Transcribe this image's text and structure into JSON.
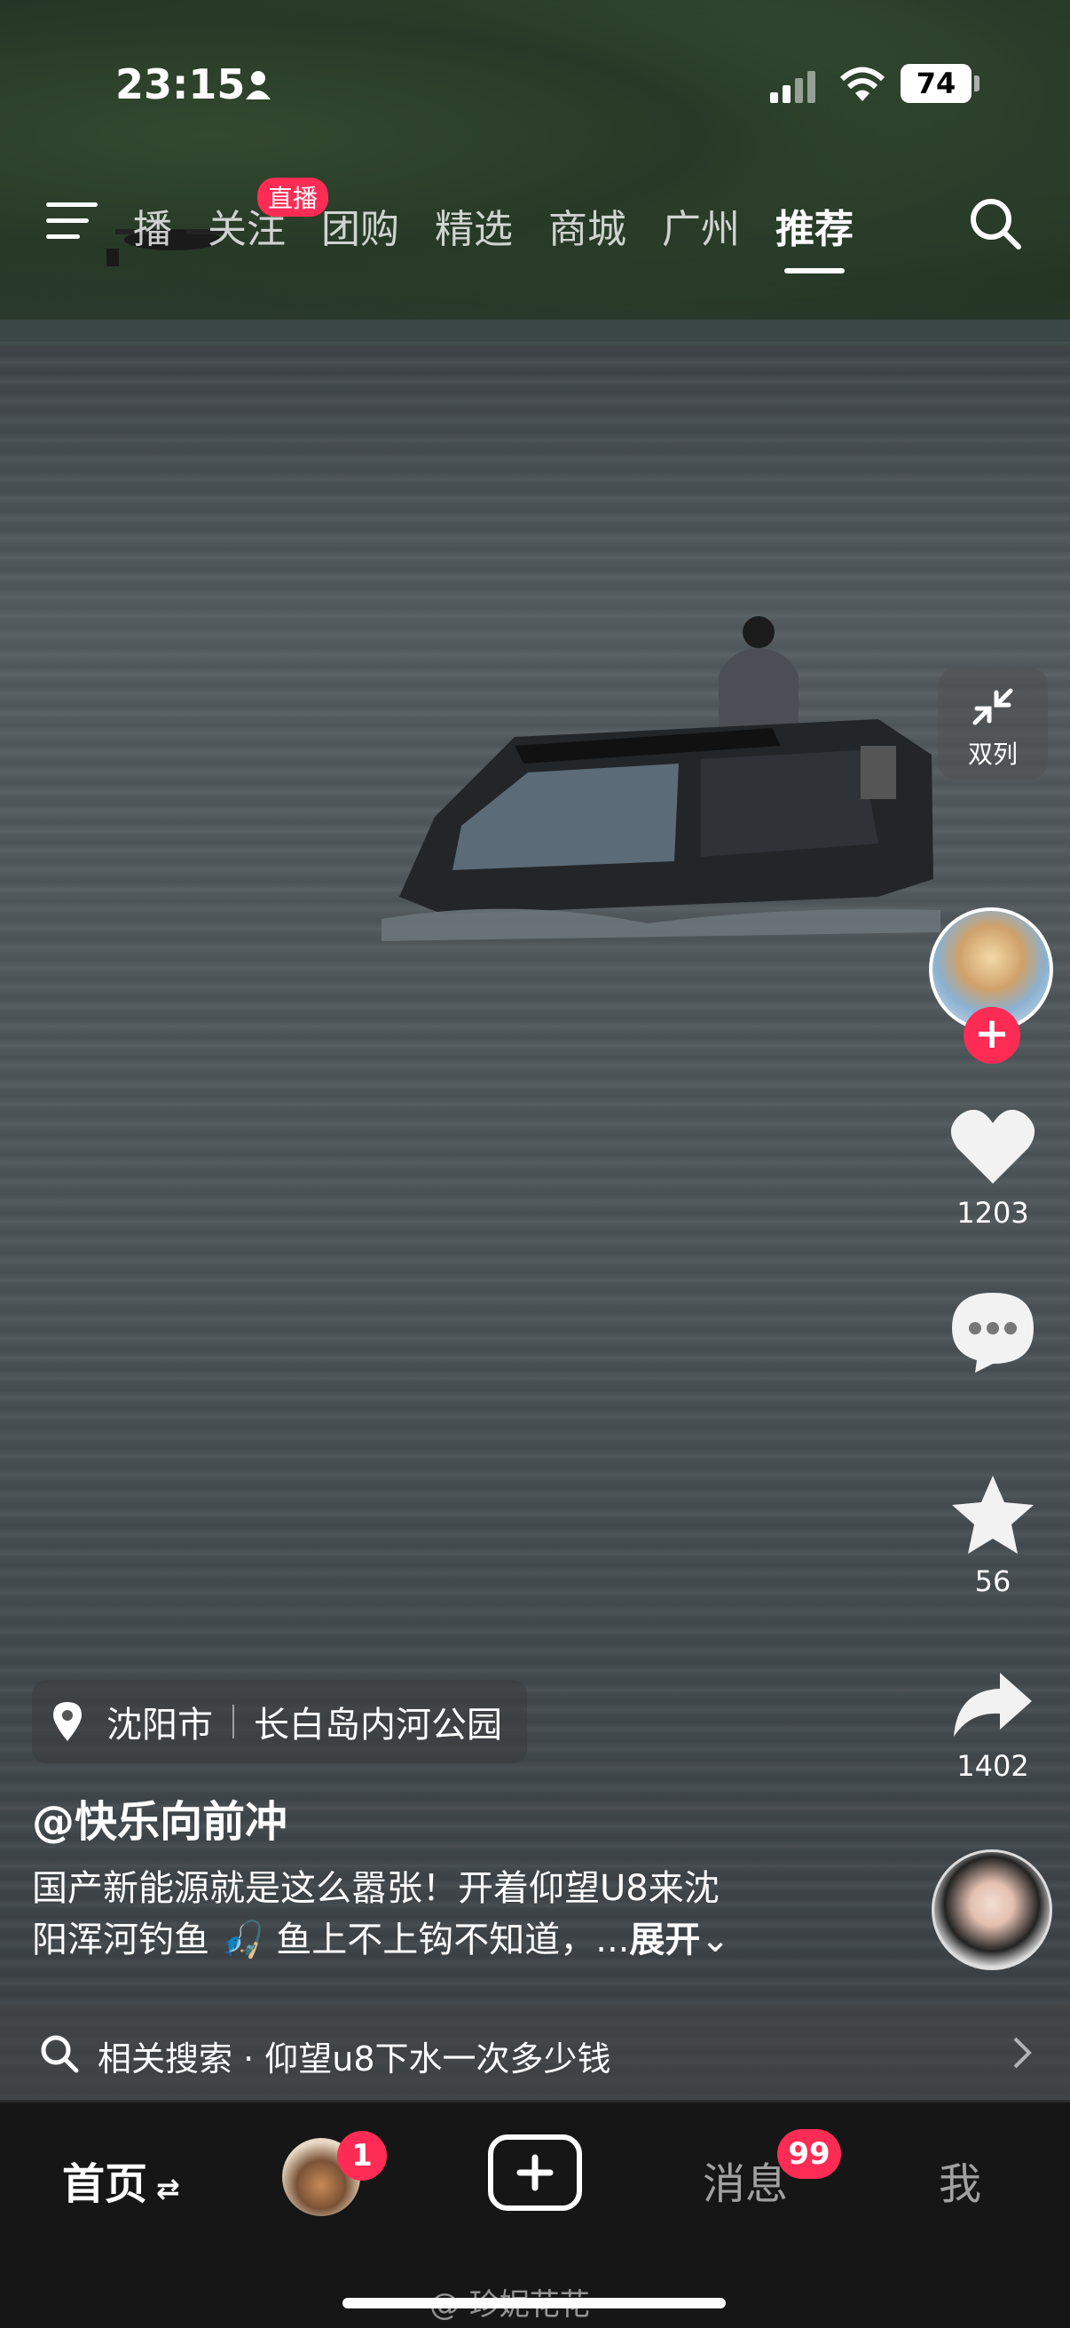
{
  "status_bar": {
    "time": "23:15",
    "battery": "74"
  },
  "top_nav": {
    "tabs": [
      "播",
      "关注",
      "团购",
      "精选",
      "商城",
      "广州",
      "推荐"
    ],
    "active_tab": "推荐",
    "live_badge": "直播"
  },
  "right_rail": {
    "dual_column_label": "双列",
    "likes": "1203",
    "favorites": "56",
    "shares": "1402"
  },
  "post": {
    "location_city": "沈阳市",
    "location_place": "长白岛内河公园",
    "author": "@快乐向前冲",
    "caption_line1": "国产新能源就是这么嚣张！开着仰望U8来沈",
    "caption_line2": "阳浑河钓鱼",
    "caption_line2b": "鱼上不上钩不知道，...",
    "expand": "展开"
  },
  "related_search": {
    "label": "相关搜索 · 仰望u8下水一次多少钱"
  },
  "tab_bar": {
    "home": "首页",
    "friends_badge": "1",
    "messages": "消息",
    "messages_badge": "99",
    "me": "我"
  },
  "watermark": "@ 珍妮花花",
  "colors": {
    "accent": "#fe2c55",
    "tabbar_bg": "#161616"
  },
  "icons": [
    "person-icon",
    "signal-icon",
    "wifi-icon",
    "menu-icon",
    "search-icon",
    "collapse-icon",
    "heart-icon",
    "comment-icon",
    "star-icon",
    "share-icon",
    "pin-icon",
    "chevron-right-icon",
    "plus-icon"
  ]
}
